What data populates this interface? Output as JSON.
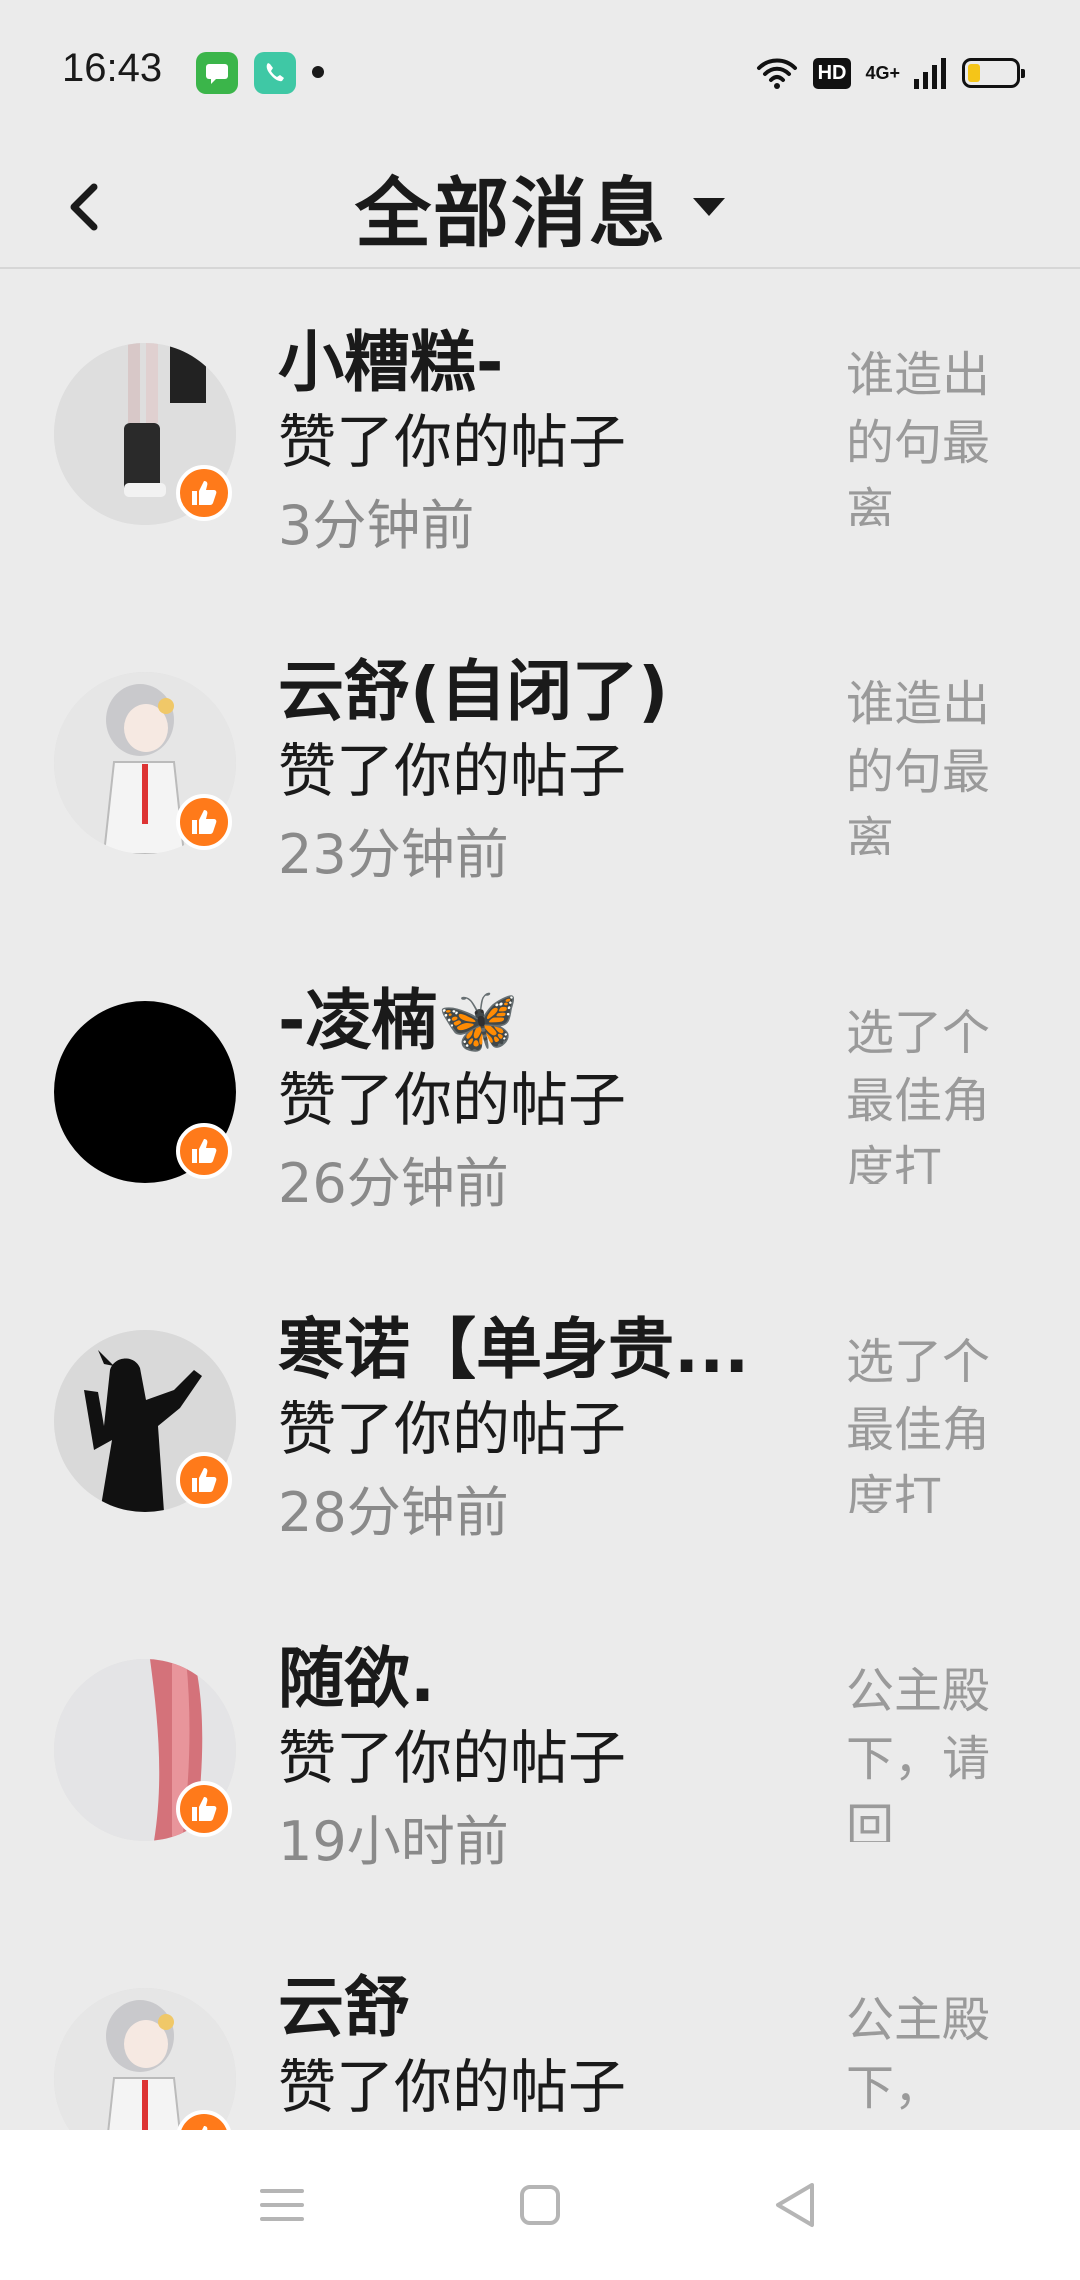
{
  "status_bar": {
    "time": "16:43",
    "icons": [
      "messages-app-icon",
      "phone-app-icon",
      "notification-dot",
      "wifi-icon",
      "hd-icon",
      "signal-icon",
      "battery-icon"
    ],
    "hd_label": "HD",
    "network_label": "4G+",
    "battery_level": 0.25
  },
  "header": {
    "title": "全部消息",
    "back_icon": "chevron-left-icon",
    "dropdown_icon": "caret-down-icon"
  },
  "messages": [
    {
      "name": "小糟糕-",
      "action": "赞了你的帖子",
      "time": "3分钟前",
      "preview": "谁造出的句最离",
      "avatar": "avatar-legs"
    },
    {
      "name": "云舒(自闭了)",
      "action": "赞了你的帖子",
      "time": "23分钟前",
      "preview": "谁造出的句最离",
      "avatar": "avatar-anime-girl"
    },
    {
      "name": "-凌楠🦋",
      "action": "赞了你的帖子",
      "time": "26分钟前",
      "preview": "选了个最佳角度打",
      "avatar": "avatar-black"
    },
    {
      "name": "寒诺【单身贵...",
      "action": "赞了你的帖子",
      "time": "28分钟前",
      "preview": "选了个最佳角度打",
      "avatar": "avatar-silhouette"
    },
    {
      "name": "随欲.",
      "action": "赞了你的帖子",
      "time": "19小时前",
      "preview": "公主殿下，请回",
      "avatar": "avatar-pink-hair"
    },
    {
      "name": "云舒",
      "action": "赞了你的帖子",
      "time": "",
      "preview": "公主殿下，",
      "avatar": "avatar-anime-girl"
    }
  ],
  "nav": {
    "menu_icon": "menu-icon",
    "home_icon": "home-square-icon",
    "back_icon": "back-triangle-icon"
  },
  "colors": {
    "background": "#ebebeb",
    "like_badge": "#ff7a1a",
    "secondary_text": "#8a8a8a"
  }
}
